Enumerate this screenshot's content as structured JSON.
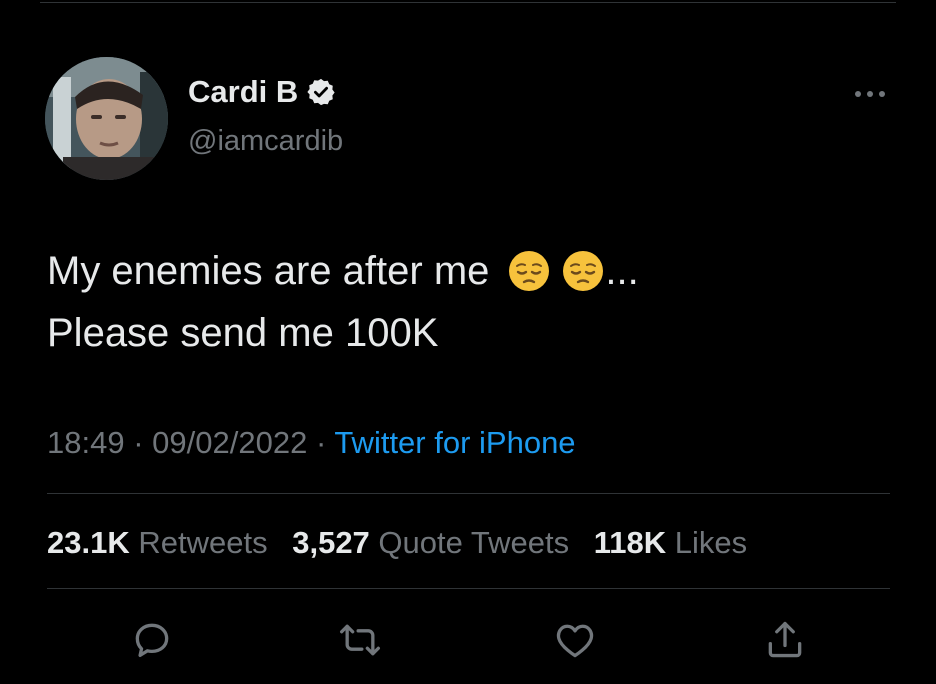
{
  "tweet": {
    "author": {
      "display_name": "Cardi B",
      "handle": "@iamcardib",
      "verified_icon": "verified-badge-icon"
    },
    "text_line1": "My enemies are after me",
    "text_line1_suffix": "...",
    "text_line2": "Please send me 100K",
    "emojis": [
      "pensive-face-emoji",
      "pensive-face-emoji"
    ],
    "time": "18:49",
    "separator": "·",
    "date": "09/02/2022",
    "source": "Twitter for iPhone",
    "stats": {
      "retweets_count": "23.1K",
      "retweets_label": "Retweets",
      "quotes_count": "3,527",
      "quotes_label": "Quote Tweets",
      "likes_count": "118K",
      "likes_label": "Likes"
    },
    "actions": [
      "reply-icon",
      "retweet-icon",
      "like-icon",
      "share-icon"
    ]
  },
  "colors": {
    "background": "#000000",
    "text_primary": "#e7e9ea",
    "text_secondary": "#71767b",
    "accent": "#1d9bf0",
    "divider": "#2f3336"
  }
}
